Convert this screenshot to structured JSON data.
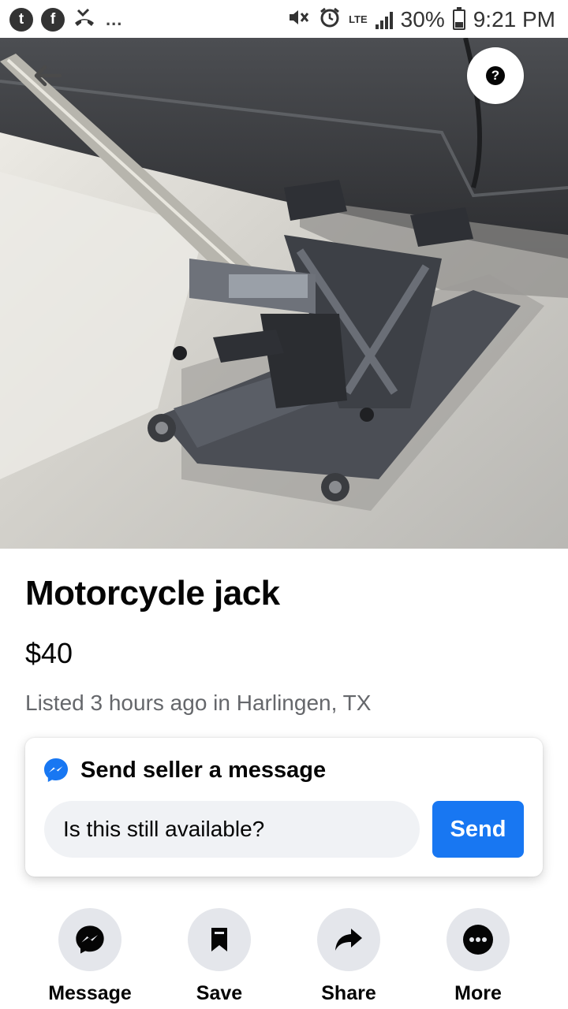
{
  "status_bar": {
    "left_icons": [
      "tumblr-icon",
      "facebook-icon",
      "missed-call-icon"
    ],
    "left_letters": [
      "t",
      "f"
    ],
    "overflow": "...",
    "network": "LTE",
    "battery": "30%",
    "time": "9:21 PM"
  },
  "photo": {
    "description_icons": [
      "back-arrow-icon",
      "help-icon"
    ],
    "help_glyph": "?"
  },
  "listing": {
    "title": "Motorcycle jack",
    "price": "$40",
    "meta": "Listed 3 hours ago in Harlingen, TX"
  },
  "message_card": {
    "title": "Send seller a message",
    "input_value": "Is this still available?",
    "send_label": "Send",
    "icon": "messenger-icon"
  },
  "actions": [
    {
      "label": "Message",
      "icon": "messenger-icon"
    },
    {
      "label": "Save",
      "icon": "bookmark-icon"
    },
    {
      "label": "Share",
      "icon": "share-arrow-icon"
    },
    {
      "label": "More",
      "icon": "more-dots-icon"
    }
  ],
  "colors": {
    "accent": "#1877f2",
    "muted_text": "#65676b",
    "input_bg": "#f0f2f5",
    "action_circle_bg": "#e4e6eb"
  }
}
